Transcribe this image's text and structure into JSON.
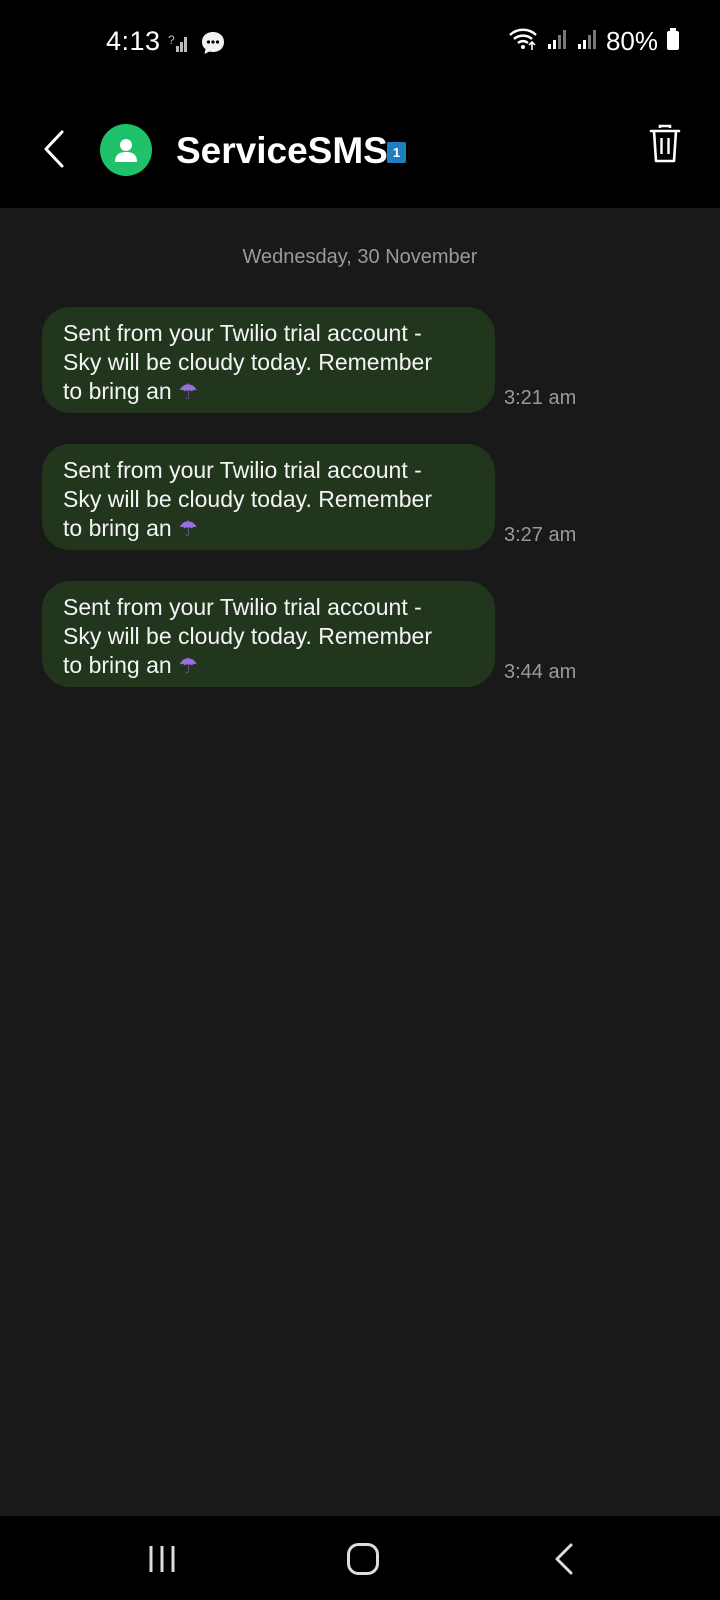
{
  "status_bar": {
    "time": "4:13",
    "battery": "80%",
    "icons": [
      "signal-unknown-icon",
      "message-notification-icon",
      "wifi-icon",
      "signal-icon",
      "signal-icon",
      "battery-icon"
    ]
  },
  "header": {
    "contact_name": "ServiceSMS",
    "sim_badge": "1",
    "icons": [
      "back-icon",
      "contact-avatar-icon",
      "trash-icon"
    ]
  },
  "conversation": {
    "date": "Wednesday, 30 November",
    "messages": [
      {
        "line1": "Sent from your Twilio trial account -",
        "line2": "Sky will be cloudy today. Remember",
        "line3": "to bring an",
        "emoji": "☂",
        "time": "3:21 am"
      },
      {
        "line1": "Sent from your Twilio trial account -",
        "line2": "Sky will be cloudy today. Remember",
        "line3": "to bring an",
        "emoji": "☂",
        "time": "3:27 am"
      },
      {
        "line1": "Sent from your Twilio trial account -",
        "line2": "Sky will be cloudy today. Remember",
        "line3": "to bring an",
        "emoji": "☂",
        "time": "3:44 am"
      }
    ]
  },
  "nav_bar": {
    "icons": [
      "recents-icon",
      "home-icon",
      "nav-back-icon"
    ]
  },
  "colors": {
    "bubble": "#22361e",
    "avatar": "#1fc26a",
    "background": "#191919",
    "sim_badge": "#1e7fbf"
  }
}
